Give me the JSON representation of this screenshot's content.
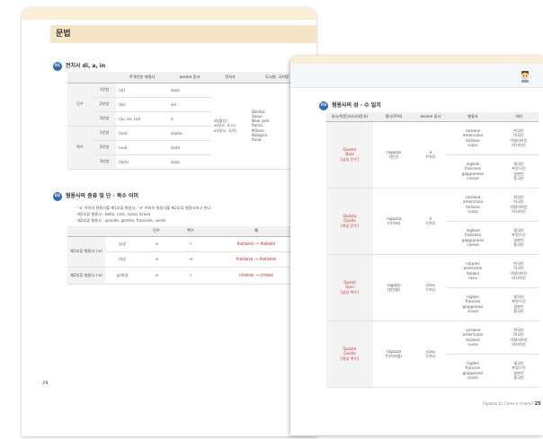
{
  "left_page": {
    "grammar_title": "문법",
    "section1": {
      "num": "01",
      "title": "전치사 di, a, in",
      "headers": [
        "",
        "",
        "주격인칭 대명사",
        "essere 동사",
        "전치사",
        "도시명, 국가명"
      ],
      "rows": [
        {
          "num": "",
          "person": "1인칭",
          "pronoun": "(io)",
          "verb": "sono"
        },
        {
          "num": "단수",
          "person": "2인칭",
          "pronoun": "(tu)",
          "verb": "sei"
        },
        {
          "num": "",
          "person": "3인칭",
          "pronoun": "(lui, lei, Lei)",
          "verb": "è"
        },
        {
          "num": "",
          "person": "1인칭",
          "pronoun": "(noi)",
          "verb": "siamo"
        },
        {
          "num": "복수",
          "person": "2인칭",
          "pronoun": "(voi)",
          "verb": "siete"
        },
        {
          "num": "",
          "person": "3인칭",
          "pronoun": "(loro)",
          "verb": "sono"
        }
      ],
      "prepositions": [
        "di(출신)",
        "a(장소: 도시)",
        "in(장소: 국가)"
      ],
      "cities": [
        "Boston",
        "Seoul",
        "New york",
        "Roma",
        "Milano",
        "Bologna",
        "Italia"
      ]
    },
    "section2": {
      "num": "02",
      "title": "형용사의 종류 및 단 · 복수 어미",
      "notes": [
        "- '-o' 어미의 형용사를 제1부류 형용사, '-e' 어미의 형용사를 제2부류 형용사라고 한다.",
        "- 제1부류 형용사 : bello, caro, rosso, bravo",
        "- 제2부류 형용사 : grande, gentile, francese, verde"
      ],
      "headers": [
        "",
        "",
        "단수",
        "복수",
        "예"
      ],
      "rows": [
        {
          "group": "제1부류 형용사 (-o)",
          "gender": "남성",
          "sing": "-o",
          "plur": "-i",
          "ex_from": "italiano",
          "ex_to": "italiani"
        },
        {
          "group": "",
          "gender": "여성",
          "sing": "-a",
          "plur": "-e",
          "ex_from": "italiana",
          "ex_to": "italiane"
        },
        {
          "group": "제2부류 형용사 (-e)",
          "gender": "남/여성",
          "sing": "-e",
          "plur": "-i",
          "ex_from": "cinese",
          "ex_to": "cinesi"
        }
      ],
      "arrow": "→"
    },
    "page_number": "24"
  },
  "right_page": {
    "section3": {
      "num": "03",
      "title": "형용사의 성 · 수 일치",
      "headers": [
        "지시/의문(지시/의문사)",
        "명사(주어)",
        "essere 동사",
        "형용사",
        "의미"
      ],
      "groups": [
        {
          "demo": "Questo\nQuel\n[남성 단수]",
          "noun": "ragazzo\n(청년)",
          "verb": "è\n(이다)",
          "adj1": "coreano\namericano\nitaliano\nrusso",
          "mean1": "한국인\n미국인\n이탈리아인\n러시아인",
          "adj2": "inglese\nfrancese\ngiapponese\ncinese",
          "mean2": "영국인\n프랑스인\n일본인\n중국인"
        },
        {
          "demo": "Questa\nQuella\n[여성 단수]",
          "noun": "ragazza\n(아가씨)",
          "verb": "è\n(이다)",
          "adj1": "coreana\namericana\nitaliana\nrussa",
          "mean1": "한국인\n미국인\n이탈리아인\n러시아인",
          "adj2": "inglese\nfrancese\ngiapponese\ncinese",
          "mean2": "영국인\n프랑스인\n일본인\n중국인"
        },
        {
          "demo": "Questi\nQuei\n[남성 복수]",
          "noun": "ragazzi\n(청년들)",
          "verb": "sono\n(이다)",
          "adj1": "coreani\namericani\nitaliani\nrussi",
          "mean1": "한국인\n미국인\n이탈리아인\n러시아인",
          "adj2": "inglesi\nfrancesi\ngiapponesi\ncinesi",
          "mean2": "영국인\n프랑스인\n일본인\n중국인"
        },
        {
          "demo": "Queste\nQuelle\n[여성 복수]",
          "noun": "ragazze\n(아가씨들)",
          "verb": "sono\n(이다)",
          "adj1": "coreane\namericane\nitaliane\nrusse",
          "mean1": "한국인\n미국인\n이탈리아인\n러시아인",
          "adj2": "inglesi\nfrancesi\ngiapponesi\ncinesi",
          "mean2": "영국인\n프랑스인\n일본인\n중국인"
        }
      ]
    },
    "footer_chapter": "Capitolo 01  Come ti chiami?",
    "page_number": "25"
  },
  "colors": {
    "accent_blue": "#2f68b4",
    "header_cream": "#f6e6c8",
    "highlight_red": "#c9312a"
  },
  "icons": [
    "character-illustration-icon"
  ]
}
